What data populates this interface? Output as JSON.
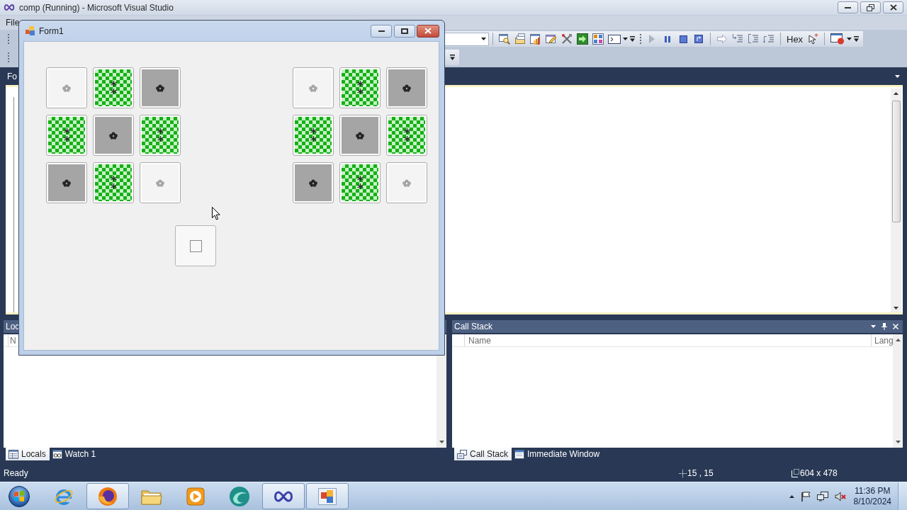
{
  "window": {
    "title": "comp (Running) - Microsoft Visual Studio"
  },
  "menu": [
    {
      "label": "File"
    }
  ],
  "toolbar": {
    "hex_label": "Hex"
  },
  "document_tabs": [
    {
      "label": "Fo"
    }
  ],
  "form": {
    "title": "Form1",
    "grids": [
      {
        "tiles": [
          {
            "kind": "plain"
          },
          {
            "kind": "checkered"
          },
          {
            "kind": "shaded"
          },
          {
            "kind": "checkered"
          },
          {
            "kind": "shaded"
          },
          {
            "kind": "checkered"
          },
          {
            "kind": "shaded"
          },
          {
            "kind": "checkered"
          },
          {
            "kind": "plain"
          }
        ]
      },
      {
        "tiles": [
          {
            "kind": "plain"
          },
          {
            "kind": "checkered"
          },
          {
            "kind": "shaded"
          },
          {
            "kind": "checkered"
          },
          {
            "kind": "shaded"
          },
          {
            "kind": "checkered"
          },
          {
            "kind": "shaded"
          },
          {
            "kind": "checkered"
          },
          {
            "kind": "plain"
          }
        ]
      }
    ]
  },
  "panels": [
    {
      "title": "Loc",
      "columns": [
        "N"
      ],
      "tabs": [
        {
          "label": "Locals",
          "selected": true
        },
        {
          "label": "Watch 1",
          "selected": false
        }
      ]
    },
    {
      "title": "Call Stack",
      "columns": [
        "Name",
        "Lang"
      ],
      "tabs": [
        {
          "label": "Call Stack",
          "selected": true
        },
        {
          "label": "Immediate Window",
          "selected": false
        }
      ]
    }
  ],
  "status_bar": {
    "text": "Ready",
    "position": "15 , 15",
    "size": "604 x 478"
  },
  "taskbar": {
    "apps": [
      {
        "active": false
      },
      {
        "active": true
      },
      {
        "active": false
      },
      {
        "active": false
      },
      {
        "active": false
      },
      {
        "active": true
      },
      {
        "active": true
      }
    ],
    "time": "11:36 PM",
    "date": "8/10/2024"
  }
}
